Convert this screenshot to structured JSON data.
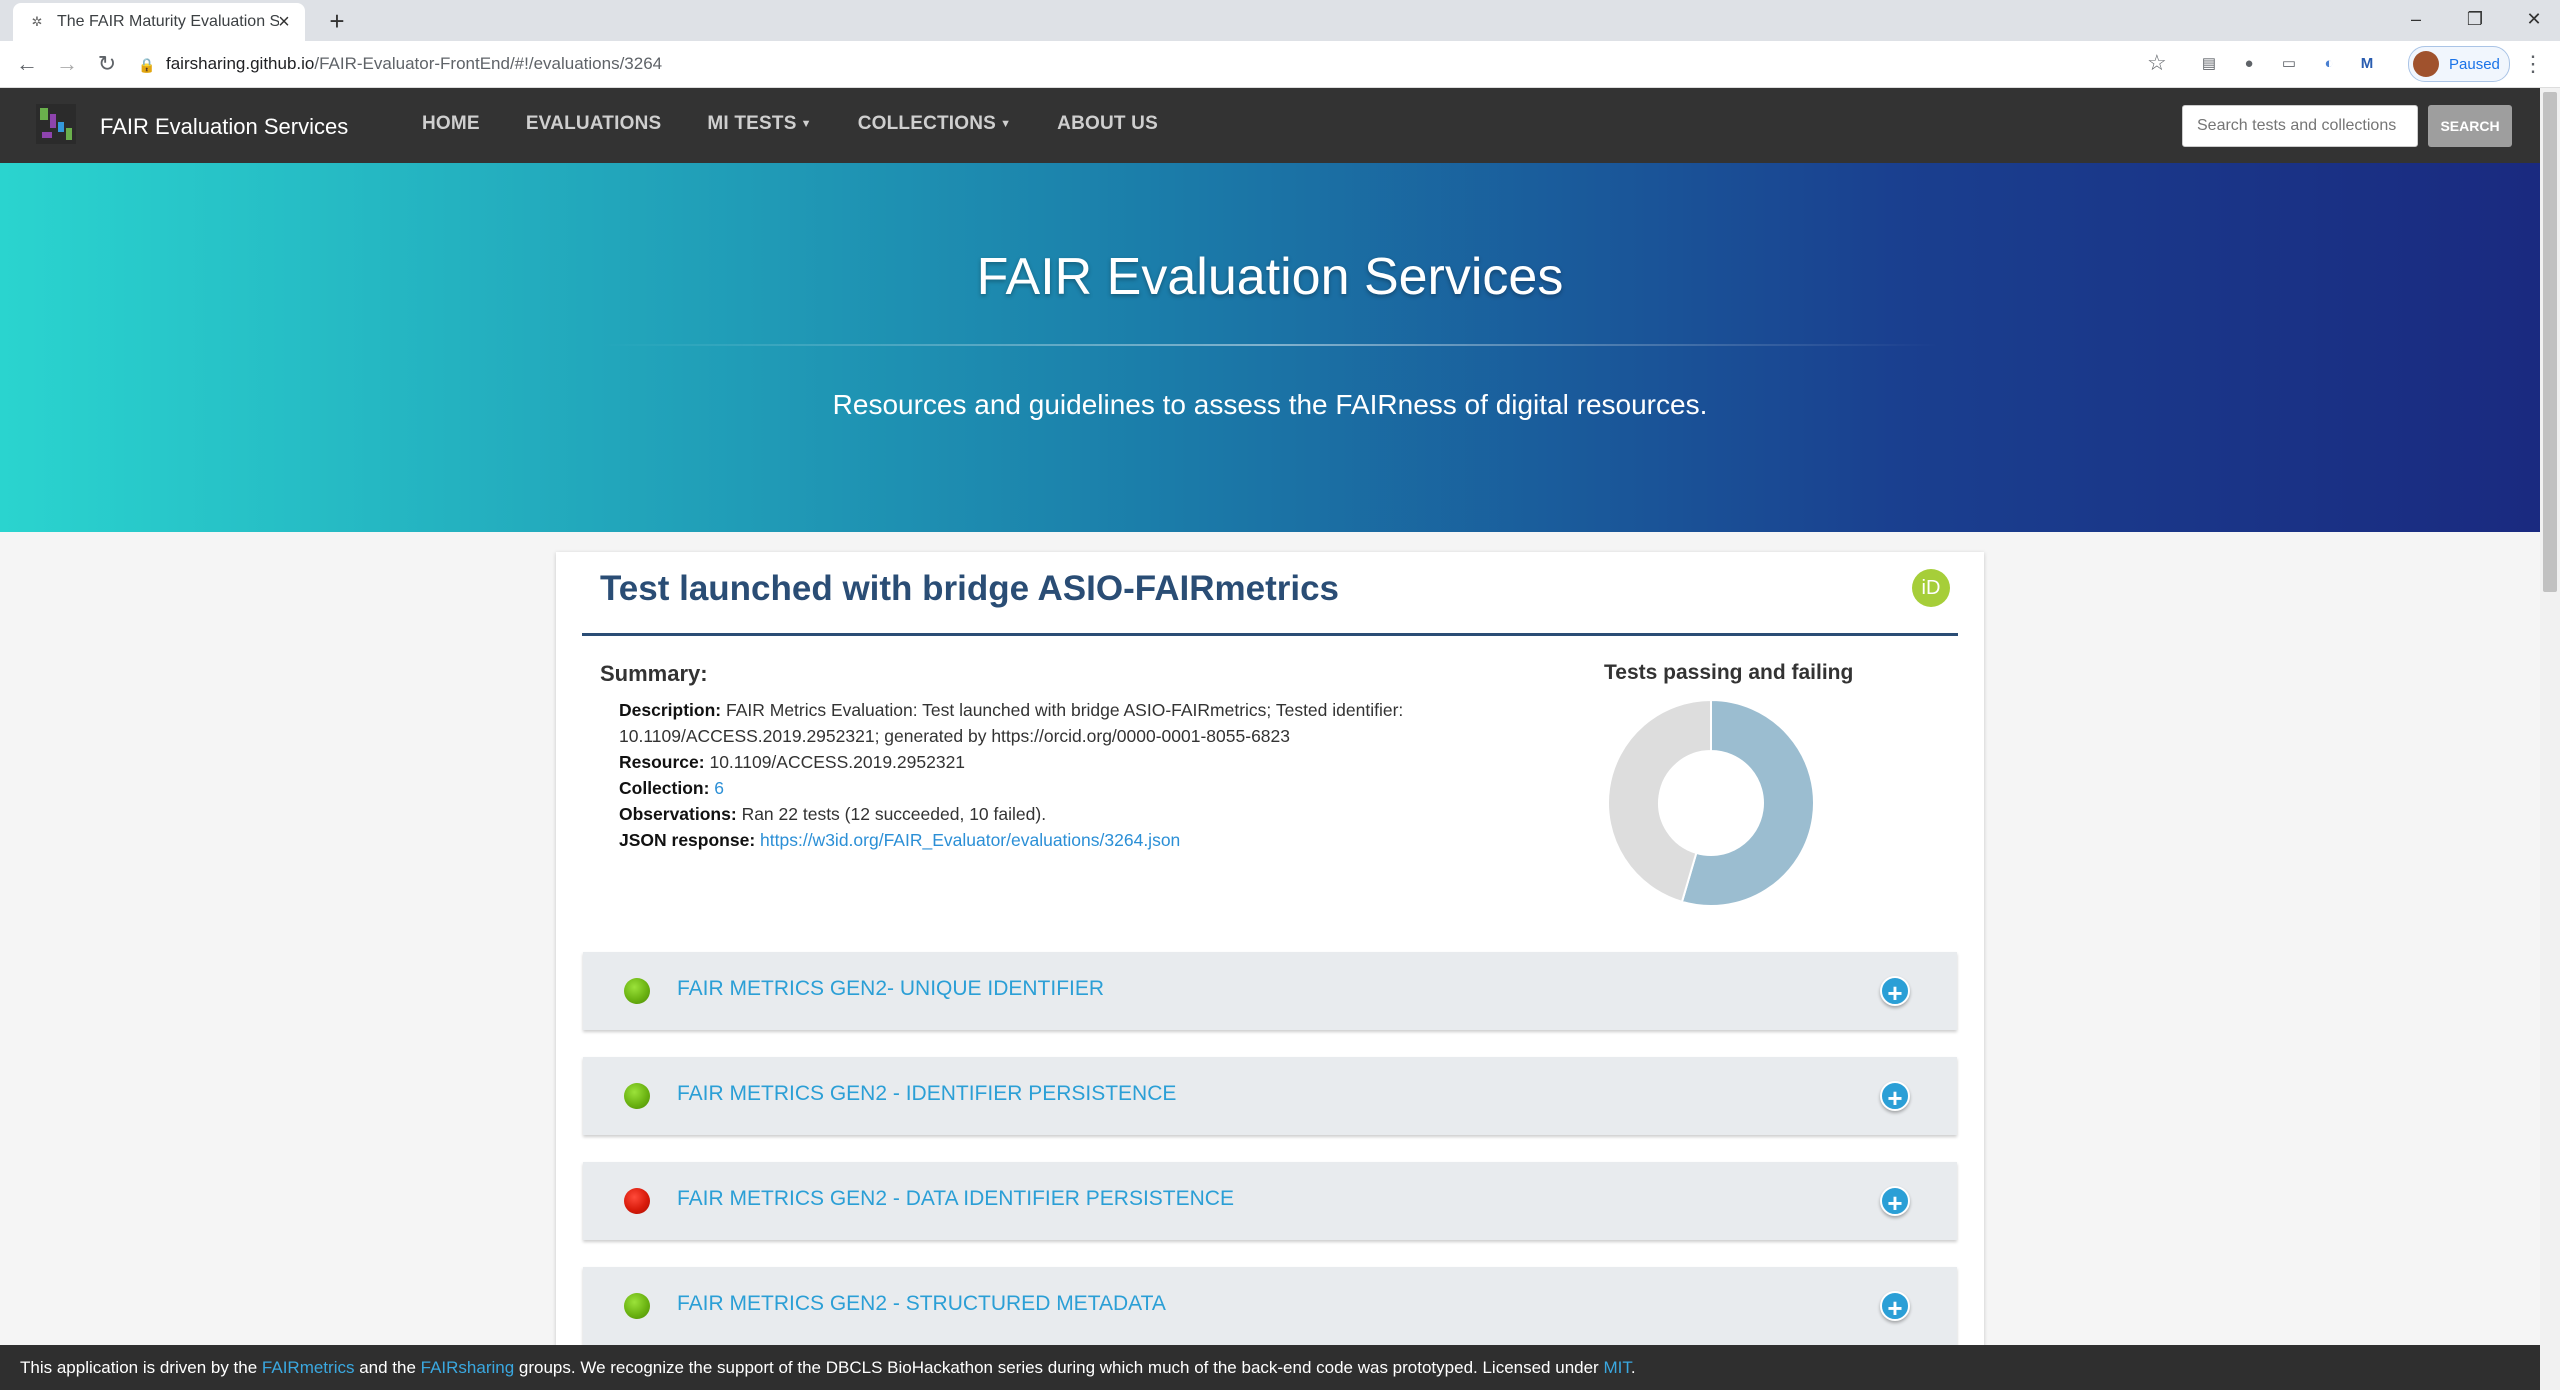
{
  "browser": {
    "tab_title": "The FAIR Maturity Evaluation Ser",
    "url_host": "fairsharing.github.io",
    "url_path": "/FAIR-Evaluator-FrontEnd/#!/evaluations/3264",
    "profile_status": "Paused"
  },
  "nav": {
    "brand": "FAIR Evaluation Services",
    "links": [
      "HOME",
      "EVALUATIONS",
      "MI TESTS",
      "COLLECTIONS",
      "ABOUT US"
    ],
    "search_placeholder": "Search tests and collections",
    "search_button": "SEARCH"
  },
  "hero": {
    "title": "FAIR Evaluation Services",
    "subtitle": "Resources and guidelines to assess the FAIRness of digital resources."
  },
  "evaluation": {
    "title": "Test launched with bridge ASIO-FAIRmetrics",
    "orcid_badge": "iD",
    "summary_heading": "Summary:",
    "description_label": "Description:",
    "description": "FAIR Metrics Evaluation: Test launched with bridge ASIO-FAIRmetrics; Tested identifier: 10.1109/ACCESS.2019.2952321; generated by https://orcid.org/0000-0001-8055-6823",
    "resource_label": "Resource:",
    "resource": "10.1109/ACCESS.2019.2952321",
    "collection_label": "Collection:",
    "collection": "6",
    "observations_label": "Observations:",
    "observations": "Ran 22 tests (12 succeeded, 10 failed).",
    "json_label": "JSON response:",
    "json_link": "https://w3id.org/FAIR_Evaluator/evaluations/3264.json"
  },
  "chart_data": {
    "type": "pie",
    "title": "Tests passing and failing",
    "categories": [
      "passed",
      "failed"
    ],
    "values": [
      12,
      10
    ],
    "colors": [
      "#9bbdd0",
      "#dddddd"
    ],
    "donut": true
  },
  "tests": [
    {
      "label": "FAIR METRICS GEN2- UNIQUE IDENTIFIER",
      "status": "pass"
    },
    {
      "label": "FAIR METRICS GEN2 - IDENTIFIER PERSISTENCE",
      "status": "pass"
    },
    {
      "label": "FAIR METRICS GEN2 - DATA IDENTIFIER PERSISTENCE",
      "status": "fail"
    },
    {
      "label": "FAIR METRICS GEN2 - STRUCTURED METADATA",
      "status": "pass"
    }
  ],
  "footer": {
    "text_1": "This application is driven by the ",
    "link_1": "FAIRmetrics",
    "text_2": " and the ",
    "link_2": "FAIRsharing",
    "text_3": " groups. We recognize the support of the DBCLS BioHackathon series during which much of the back-end code was prototyped. Licensed under ",
    "link_3": "MIT",
    "text_4": "."
  }
}
